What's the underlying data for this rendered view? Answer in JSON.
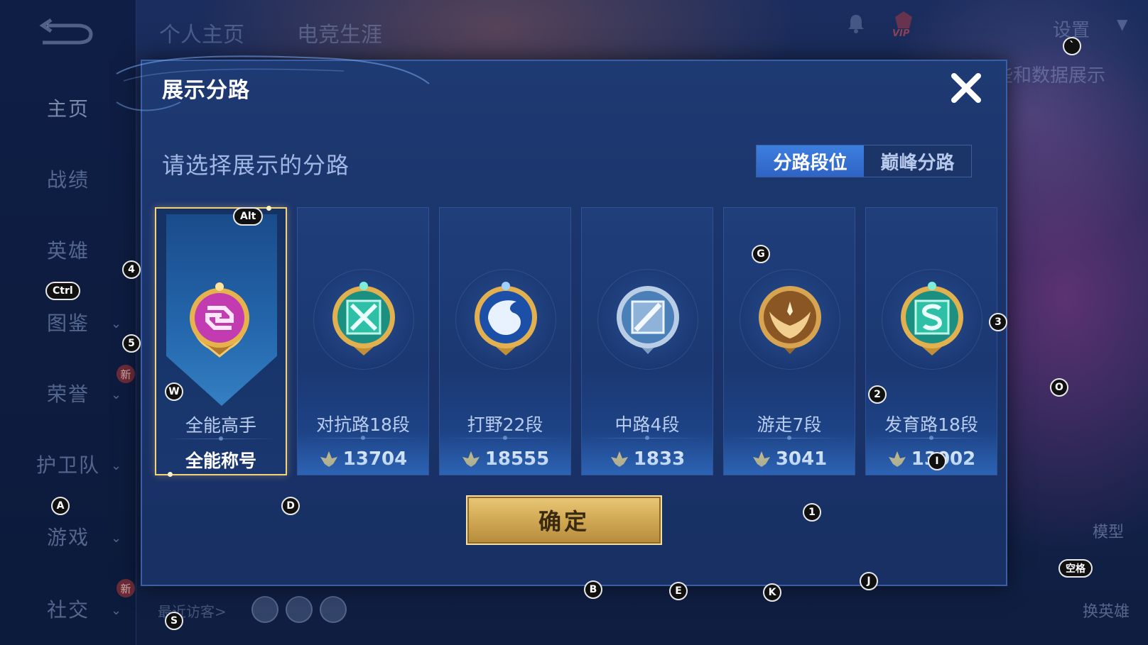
{
  "background": {
    "top_tabs": [
      "个人主页",
      "电竞生涯"
    ],
    "settings_label": "设置",
    "behind_text": "些和数据展示",
    "left_nav": [
      {
        "label": "主页",
        "active": true,
        "chevron": false,
        "badge": ""
      },
      {
        "label": "战绩",
        "active": false,
        "chevron": false,
        "badge": ""
      },
      {
        "label": "英雄",
        "active": false,
        "chevron": false,
        "badge": ""
      },
      {
        "label": "图鉴",
        "active": false,
        "chevron": true,
        "badge": ""
      },
      {
        "label": "荣誉",
        "active": false,
        "chevron": true,
        "badge": "新"
      },
      {
        "label": "护卫队",
        "active": false,
        "chevron": true,
        "badge": ""
      },
      {
        "label": "游戏",
        "active": false,
        "chevron": true,
        "badge": ""
      },
      {
        "label": "社交",
        "active": false,
        "chevron": true,
        "badge": "新"
      }
    ],
    "recent_visitors_label": "最近访客>",
    "model_label": "模型",
    "switch_hero_label": "换英雄",
    "vip_label": "VIP"
  },
  "dialog": {
    "title": "展示分路",
    "close_label": "✕",
    "subtitle": "请选择展示的分路",
    "toggle": {
      "options": [
        {
          "label": "分路段位",
          "active": true
        },
        {
          "label": "巅峰分路",
          "active": false
        }
      ]
    },
    "cards": [
      {
        "name": "全能高手",
        "value": "全能称号",
        "kind": "title",
        "selected": true,
        "emblem": "all-round-emblem-icon",
        "color": "#c23bb0"
      },
      {
        "name": "对抗路18段",
        "value": "13704",
        "kind": "points",
        "selected": false,
        "emblem": "clash-lane-emblem-icon",
        "color": "#2ec0a7"
      },
      {
        "name": "打野22段",
        "value": "18555",
        "kind": "points",
        "selected": false,
        "emblem": "jungle-emblem-icon",
        "color": "#2a6fd4"
      },
      {
        "name": "中路4段",
        "value": "1833",
        "kind": "points",
        "selected": false,
        "emblem": "mid-lane-emblem-icon",
        "color": "#8fb2d8"
      },
      {
        "name": "游走7段",
        "value": "3041",
        "kind": "points",
        "selected": false,
        "emblem": "roam-emblem-icon",
        "color": "#c8903f"
      },
      {
        "name": "发育路18段",
        "value": "13002",
        "kind": "points",
        "selected": false,
        "emblem": "farm-lane-emblem-icon",
        "color": "#2ec0a7"
      }
    ],
    "confirm_label": "确定"
  },
  "hotkeys": [
    {
      "key": "Alt"
    },
    {
      "key": "4"
    },
    {
      "key": "Ctrl"
    },
    {
      "key": "5"
    },
    {
      "key": "W"
    },
    {
      "key": "A"
    },
    {
      "key": "D"
    },
    {
      "key": "G"
    },
    {
      "key": "3"
    },
    {
      "key": "2"
    },
    {
      "key": "I"
    },
    {
      "key": "O"
    },
    {
      "key": "1"
    },
    {
      "key": "B"
    },
    {
      "key": "E"
    },
    {
      "key": "K"
    },
    {
      "key": "J"
    },
    {
      "key": "空格"
    },
    {
      "key": "S"
    },
    {
      "key": "`"
    }
  ]
}
